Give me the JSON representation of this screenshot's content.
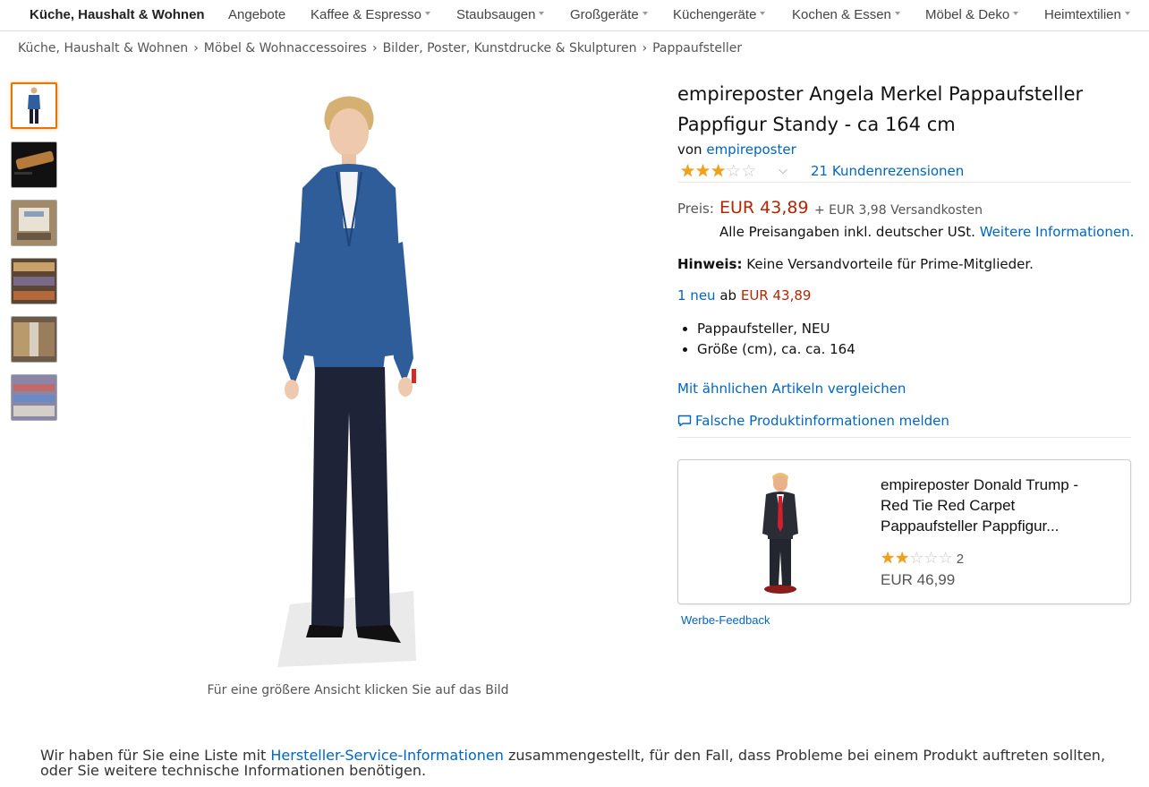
{
  "nav": {
    "home": "Küche, Haushalt & Wohnen",
    "items": [
      {
        "label": "Angebote",
        "caret": false
      },
      {
        "label": "Kaffee & Espresso",
        "caret": true
      },
      {
        "label": "Staubsaugen",
        "caret": true
      },
      {
        "label": "Großgeräte",
        "caret": true
      },
      {
        "label": "Küchengeräte",
        "caret": true
      },
      {
        "label": "Kochen & Essen",
        "caret": true
      },
      {
        "label": "Möbel & Deko",
        "caret": true
      },
      {
        "label": "Heimtextilien",
        "caret": true
      }
    ]
  },
  "breadcrumb": [
    "Küche, Haushalt & Wohnen",
    "Möbel & Wohnaccessoires",
    "Bilder, Poster, Kunstdrucke & Skulpturen",
    "Pappaufsteller"
  ],
  "gallery": {
    "thumbnails": [
      "thumb-standee-front",
      "thumb-packaging-tube",
      "thumb-box-open",
      "thumb-warehouse-shelves",
      "thumb-warehouse-aisle",
      "thumb-warehouse-store"
    ],
    "hint": "Für eine größere Ansicht klicken Sie auf das Bild"
  },
  "product": {
    "title": "empireposter Angela Merkel Pappaufsteller Pappfigur Standy - ca 164 cm",
    "by": "von",
    "brand": "empireposter",
    "rating": 3,
    "rating_max": 5,
    "reviews": "21 Kundenrezensionen",
    "price_label": "Preis:",
    "price": "EUR 43,89",
    "shipping": "+ EUR 3,98 Versandkosten",
    "vat_note": "Alle Preisangaben inkl. deutscher USt.",
    "vat_link": "Weitere Informationen.",
    "hinweis_label": "Hinweis:",
    "hinweis_text": "Keine Versandvorteile für Prime-Mitglieder.",
    "offers_count": "1 neu",
    "offers_ab": "ab",
    "offers_price": "EUR 43,89",
    "bullets": [
      "Pappaufsteller, NEU",
      "Größe (cm), ca. ca. 164"
    ],
    "compare_link": "Mit ähnlichen Artikeln vergleichen",
    "report_link": "Falsche Produktinformationen melden"
  },
  "ad": {
    "title": "empireposter Donald Trump - Red Tie Red Carpet Pappaufsteller Pappfigur...",
    "rating": 2,
    "rating_max": 5,
    "count": "2",
    "price": "EUR 46,99",
    "feedback": "Werbe-Feedback"
  },
  "manufacturer": {
    "pre": "Wir haben für Sie eine Liste mit",
    "link": "Hersteller-Service-Informationen",
    "post": "zusammengestellt, für den Fall, dass Probleme bei einem Produkt auftreten sollten, oder Sie weitere technische Informationen benötigen."
  },
  "colors": {
    "link": "#0066c0",
    "price": "#b12704",
    "star": "#f0a11c",
    "thumb_active": "#e77600"
  },
  "icons": {
    "review_chevron": "chevron-down-icon",
    "report": "speech-bubble-icon"
  }
}
